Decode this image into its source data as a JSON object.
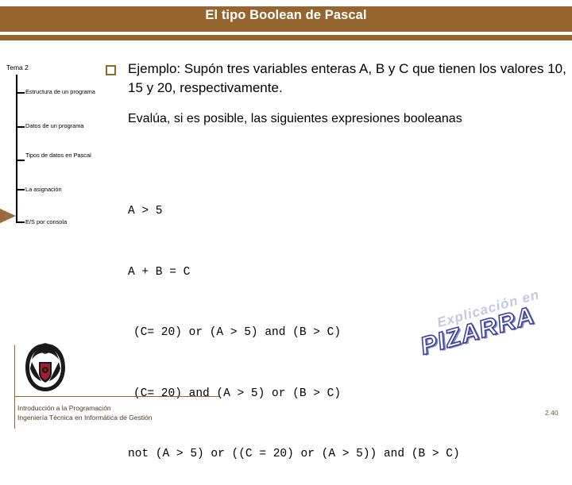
{
  "slide": {
    "title": "El tipo Boolean de Pascal",
    "accent_color": "#96652F",
    "page_number": "2.40"
  },
  "sidebar": {
    "topic_label": "Tema 2",
    "active_index": 2,
    "items": [
      {
        "label": "Estructura de un programa"
      },
      {
        "label": "Datos de un programa"
      },
      {
        "label": "Tipos de datos en Pascal"
      },
      {
        "label": "La asignación"
      },
      {
        "label": "E/S por consola"
      }
    ]
  },
  "content": {
    "bullet_icon": "hollow-square-bullet",
    "bullet_text": "Ejemplo: Supón tres variables enteras A, B y C que tienen los valores 10, 15 y 20, respectivamente.",
    "subheading": "Evalúa, si es posible, las siguientes expresiones booleanas",
    "expressions": [
      "A > 5",
      "A + B = C",
      "(C= 20) or (A > 5) and (B > C)",
      "(C= 20) and (A > 5) or (B > C)",
      "not (A > 5) or ((C = 20) or (A > 5)) and (B > C)"
    ]
  },
  "wordart": {
    "line1": "Explicación en",
    "line2": "PIZARRA",
    "line1_color": "#C3C8E4",
    "line2_outline_color": "#3B3FA0"
  },
  "footer": {
    "course": "Introducción a la Programación",
    "degree": "Ingeniería Técnica en Informática de Gestión",
    "logo": "university-crest"
  }
}
